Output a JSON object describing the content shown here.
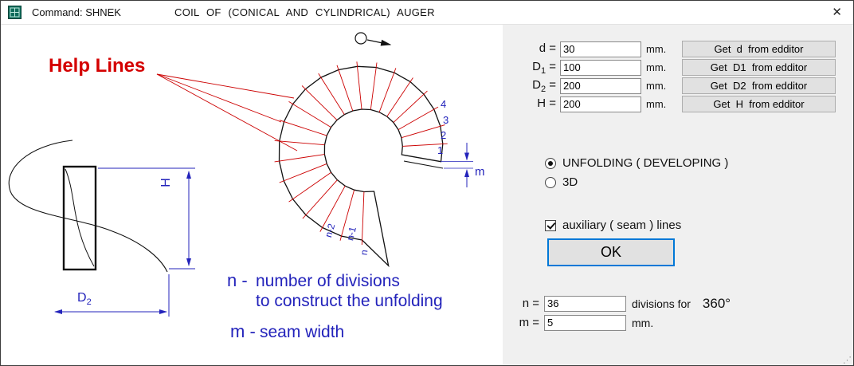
{
  "window": {
    "title_left": "Command: SHNEK",
    "title_right": "COIL OF (CONICAL AND CYLINDRICAL) AUGER",
    "close": "✕",
    "resize_grip": "⋰"
  },
  "drawing": {
    "help_lines_label": "Help Lines",
    "div_numbers": [
      "4",
      "3",
      "2",
      "1"
    ],
    "seam_label": "m",
    "n_labels": [
      "n-2",
      "n-1",
      "n"
    ],
    "h_label": "H",
    "d2_label": "D",
    "d2_sub": "2",
    "note_n_prefix": "n -",
    "note_n_text1": "number of divisions",
    "note_n_text2": "to construct the unfolding",
    "note_m_prefix": "m -",
    "note_m_text": "seam width"
  },
  "panel": {
    "fields": [
      {
        "label": "d",
        "sub": "",
        "eq": "=",
        "value": "30",
        "unit": "mm.",
        "button": "Get  d  from edditor"
      },
      {
        "label": "D",
        "sub": "1",
        "eq": "=",
        "value": "100",
        "unit": "mm.",
        "button": "Get  D1  from edditor"
      },
      {
        "label": "D",
        "sub": "2",
        "eq": "=",
        "value": "200",
        "unit": "mm.",
        "button": "Get  D2  from edditor"
      },
      {
        "label": "H",
        "sub": "",
        "eq": "=",
        "value": "200",
        "unit": "mm.",
        "button": "Get  H  from edditor"
      }
    ],
    "radio": [
      {
        "label": "UNFOLDING ( DEVELOPING )",
        "selected": true
      },
      {
        "label": "3D",
        "selected": false
      }
    ],
    "checkbox": {
      "label": "auxiliary ( seam ) lines",
      "checked": true
    },
    "ok": "OK",
    "n_row": {
      "label": "n =",
      "value": "36",
      "suffix": "divisions for",
      "degrees": "360°"
    },
    "m_row": {
      "label": "m =",
      "value": "5",
      "unit": "mm."
    }
  },
  "colors": {
    "accent_blue": "#2323bb",
    "help_red": "#d40000",
    "focus_blue": "#0078d7",
    "panel_gray": "#f0f0f0"
  }
}
